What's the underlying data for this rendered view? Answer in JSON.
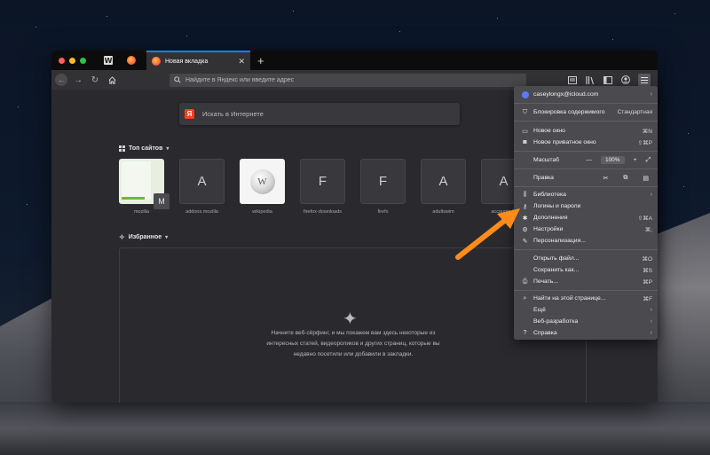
{
  "browser": {
    "active_tab_title": "Новая вкладка",
    "address_placeholder": "Найдите в Яндекс или введите адрес",
    "accent_color": "#0a84ff"
  },
  "newtab": {
    "search_placeholder": "Искать в Интернете",
    "top_sites_title": "Топ сайтов",
    "top_sites": [
      {
        "label": "mozilla",
        "letter": "M"
      },
      {
        "label": "addons.mozilla",
        "letter": "A"
      },
      {
        "label": "wikipedia",
        "letter": ""
      },
      {
        "label": "firefox-downloads",
        "letter": "F"
      },
      {
        "label": "firefx",
        "letter": "F"
      },
      {
        "label": "adultswim",
        "letter": "A"
      },
      {
        "label": "accounts.fir",
        "letter": "A"
      }
    ],
    "highlights_title": "Избранное",
    "empty_message": "Начните веб-сёрфинг, и мы покажем вам здесь некоторые из интересных статей, видеороликов и других страниц, которые вы недавно посетили или добавили в закладки."
  },
  "menu": {
    "account": "caseylongx@icloud.com",
    "content_blocking": "Блокировка содержимого",
    "content_blocking_value": "Стандартная",
    "new_window": "Новое окно",
    "new_window_sc": "⌘N",
    "new_private": "Новое приватное окно",
    "new_private_sc": "⇧⌘P",
    "zoom_label": "Масштаб",
    "zoom_minus": "—",
    "zoom_value": "100%",
    "zoom_plus": "+",
    "edit_label": "Правка",
    "library": "Библиотека",
    "logins": "Логины и пароли",
    "addons": "Дополнения",
    "addons_sc": "⇧⌘A",
    "preferences": "Настройки",
    "preferences_sc": "⌘,",
    "customize": "Персонализация...",
    "open_file": "Открыть файл...",
    "open_file_sc": "⌘O",
    "save_as": "Сохранить как...",
    "save_as_sc": "⌘S",
    "print": "Печать...",
    "print_sc": "⌘P",
    "find": "Найти на этой странице...",
    "find_sc": "⌘F",
    "more": "Ещё",
    "web_dev": "Веб-разработка",
    "help": "Справка"
  },
  "annotation": {
    "arrow_color": "#ff8c1a"
  }
}
